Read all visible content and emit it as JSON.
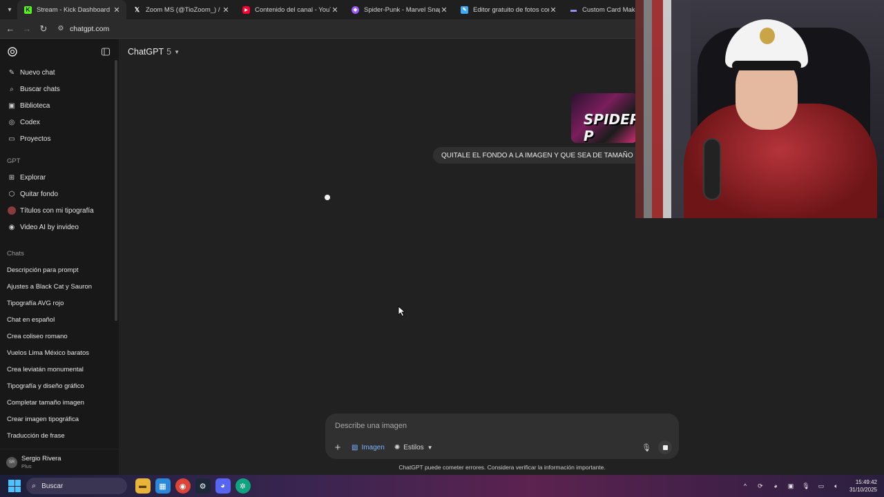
{
  "browser": {
    "tabs": [
      {
        "title": "Stream - Kick Dashboard",
        "favicon": "kick-icon",
        "color": "#53fc18",
        "active": true
      },
      {
        "title": "Zoom MS (@TioZoom_) / X",
        "favicon": "x-icon",
        "color": "#ffffff",
        "active": false
      },
      {
        "title": "Contenido del canal - YouTube",
        "favicon": "youtube-icon",
        "color": "#ff0033",
        "active": false
      },
      {
        "title": "Spider-Punk - Marvel Snap Card",
        "favicon": "snap-icon",
        "color": "#9b59ff",
        "active": false
      },
      {
        "title": "Editor gratuito de fotos con IA",
        "favicon": "editor-icon",
        "color": "#3fa9f5",
        "active": false
      },
      {
        "title": "Custom Card Maker",
        "favicon": "card-icon",
        "color": "#9aa0ff",
        "active": false
      }
    ],
    "url": "chatgpt.com"
  },
  "sidebar": {
    "items": [
      {
        "label": "Nuevo chat",
        "icon": "new-chat-icon"
      },
      {
        "label": "Buscar chats",
        "icon": "search-icon"
      },
      {
        "label": "Biblioteca",
        "icon": "library-icon"
      },
      {
        "label": "Codex",
        "icon": "codex-icon"
      },
      {
        "label": "Proyectos",
        "icon": "folder-icon"
      }
    ],
    "gpt_section": "GPT",
    "gpts": [
      {
        "label": "Explorar",
        "icon": "grid-icon"
      },
      {
        "label": "Quitar fondo",
        "icon": "cube-icon"
      },
      {
        "label": "Títulos con mi tipografía",
        "icon": "gpt-avatar-icon"
      },
      {
        "label": "Video AI by invideo",
        "icon": "video-icon"
      }
    ],
    "chats_section": "Chats",
    "chats": [
      "Descripción para prompt",
      "Ajustes a Black Cat y Sauron",
      "Tipografía AVG rojo",
      "Chat en español",
      "Crea coliseo romano",
      "Vuelos Lima México baratos",
      "Crea leviatán monumental",
      "Tipografía y diseño gráfico",
      "Completar tamaño imagen",
      "Crear imagen tipográfica",
      "Traducción de frase"
    ],
    "user": {
      "name": "Sergio Rivera",
      "plan": "Plus",
      "initials": "SR"
    }
  },
  "main": {
    "model": "ChatGPT",
    "model_version": "5",
    "image_text": "SPIDER-P",
    "user_message": "QUITALE EL FONDO A LA IMAGEN Y QUE SEA DE TAMAÑO",
    "composer": {
      "placeholder": "Describe una imagen",
      "image_label": "Imagen",
      "styles_label": "Estilos"
    },
    "disclaimer": "ChatGPT puede cometer errores. Considera verificar la información importante."
  },
  "taskbar": {
    "search": "Buscar",
    "time": "15:49:42",
    "date": "31/10/2025"
  }
}
